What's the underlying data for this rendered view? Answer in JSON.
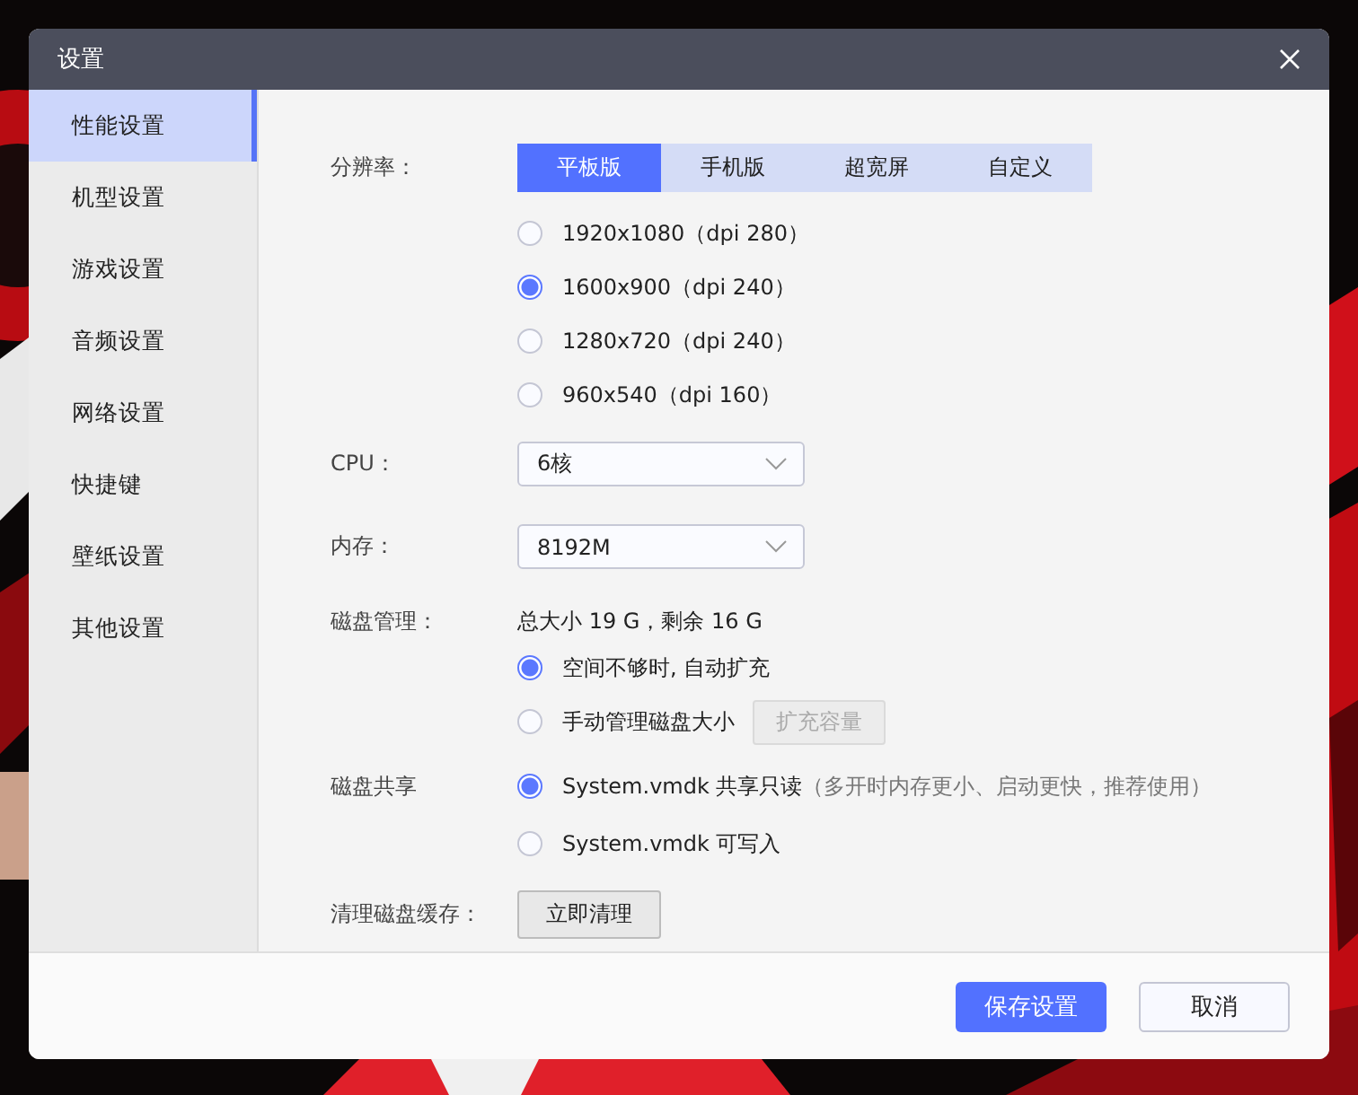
{
  "window": {
    "title": "设置"
  },
  "sidebar": {
    "items": [
      {
        "label": "性能设置",
        "selected": true
      },
      {
        "label": "机型设置",
        "selected": false
      },
      {
        "label": "游戏设置",
        "selected": false
      },
      {
        "label": "音频设置",
        "selected": false
      },
      {
        "label": "网络设置",
        "selected": false
      },
      {
        "label": "快捷键",
        "selected": false
      },
      {
        "label": "壁纸设置",
        "selected": false
      },
      {
        "label": "其他设置",
        "selected": false
      }
    ]
  },
  "resolution": {
    "label": "分辨率：",
    "tabs": [
      {
        "label": "平板版",
        "selected": true
      },
      {
        "label": "手机版",
        "selected": false
      },
      {
        "label": "超宽屏",
        "selected": false
      },
      {
        "label": "自定义",
        "selected": false
      }
    ],
    "options": [
      {
        "label": "1920x1080（dpi 280）",
        "selected": false
      },
      {
        "label": "1600x900（dpi 240）",
        "selected": true
      },
      {
        "label": "1280x720（dpi 240）",
        "selected": false
      },
      {
        "label": "960x540（dpi 160）",
        "selected": false
      }
    ]
  },
  "cpu": {
    "label": "CPU：",
    "value": "6核"
  },
  "memory": {
    "label": "内存：",
    "value": "8192M"
  },
  "disk": {
    "label": "磁盘管理：",
    "summary": "总大小 19 G，剩余 16 G",
    "options": [
      {
        "label": "空间不够时, 自动扩充",
        "selected": true
      },
      {
        "label": "手动管理磁盘大小",
        "selected": false,
        "button": {
          "label": "扩充容量",
          "disabled": true
        }
      }
    ]
  },
  "disk_share": {
    "label": "磁盘共享",
    "options": [
      {
        "label": "System.vmdk 共享只读",
        "note": "（多开时内存更小、启动更快，推荐使用）",
        "selected": true
      },
      {
        "label": "System.vmdk 可写入",
        "selected": false
      }
    ]
  },
  "cache": {
    "label": "清理磁盘缓存：",
    "button": "立即清理"
  },
  "footer": {
    "buttons": [
      {
        "label": "保存设置",
        "kind": "primary"
      },
      {
        "label": "取消",
        "kind": "secondary"
      }
    ]
  }
}
